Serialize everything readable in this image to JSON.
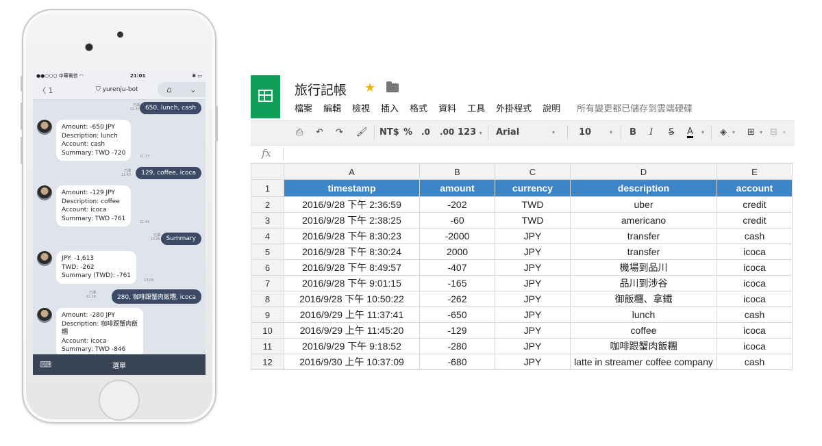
{
  "phone": {
    "status": {
      "carrier": "中華電信",
      "time": "21:01"
    },
    "header": {
      "back": "1",
      "title": "yurenju-bot"
    },
    "messages": [
      {
        "side": "right",
        "text": "650, lunch, cash",
        "read": "已讀",
        "time": "11:37"
      },
      {
        "side": "left",
        "text": "Amount: -650 JPY\nDescription: lunch\nAccount: cash\nSummary: TWD -720",
        "time": "11:37"
      },
      {
        "side": "right",
        "text": "129, coffee, icoca",
        "read": "已讀",
        "time": "11:45"
      },
      {
        "side": "left",
        "text": "Amount: -129 JPY\nDescription: coffee\nAccount: icoca\nSummary: TWD -761",
        "time": "11:45"
      },
      {
        "side": "right",
        "text": "Summary",
        "read": "已讀",
        "time": "13:09"
      },
      {
        "side": "left",
        "text": "JPY: -1,613\nTWD: -262\nSummary (TWD): -761",
        "time": "13:09"
      },
      {
        "side": "right",
        "text": "280, 咖啡跟蟹肉飯糰, icoca",
        "read": "已讀",
        "time": "21:18"
      },
      {
        "side": "left",
        "text": "Amount: -280 JPY\nDescription: 咖啡跟蟹肉飯\n糰\nAccount: icoca\nSummary: TWD -846",
        "time": "21:18"
      }
    ],
    "menu_label": "選單"
  },
  "sheet": {
    "title": "旅行記帳",
    "menu": [
      "檔案",
      "編輯",
      "檢視",
      "插入",
      "格式",
      "資料",
      "工具",
      "外掛程式",
      "說明"
    ],
    "saved_status": "所有變更都已儲存到雲端硬碟",
    "toolbar": {
      "currency": "NT$",
      "percent": "%",
      "dec_less": ".0",
      "dec_more": ".00",
      "format": "123",
      "font": "Arial",
      "size": "10",
      "bold": "B",
      "italic": "I",
      "strike": "S",
      "text_color": "A"
    },
    "fx": "fx",
    "columns": [
      "A",
      "B",
      "C",
      "D",
      "E"
    ],
    "header_row": {
      "num": "1",
      "cells": [
        "timestamp",
        "amount",
        "currency",
        "description",
        "account"
      ]
    },
    "rows": [
      {
        "num": "2",
        "cells": [
          "2016/9/28 下午 2:36:59",
          "-202",
          "TWD",
          "uber",
          "credit"
        ]
      },
      {
        "num": "3",
        "cells": [
          "2016/9/28 下午 2:38:25",
          "-60",
          "TWD",
          "americano",
          "credit"
        ]
      },
      {
        "num": "4",
        "cells": [
          "2016/9/28 下午 8:30:23",
          "-2000",
          "JPY",
          "transfer",
          "cash"
        ]
      },
      {
        "num": "5",
        "cells": [
          "2016/9/28 下午 8:30:24",
          "2000",
          "JPY",
          "transfer",
          "icoca"
        ]
      },
      {
        "num": "6",
        "cells": [
          "2016/9/28 下午 8:49:57",
          "-407",
          "JPY",
          "機場到品川",
          "icoca"
        ]
      },
      {
        "num": "7",
        "cells": [
          "2016/9/28 下午 9:01:15",
          "-165",
          "JPY",
          "品川到涉谷",
          "icoca"
        ]
      },
      {
        "num": "8",
        "cells": [
          "2016/9/28 下午 10:50:22",
          "-262",
          "JPY",
          "御飯糰、拿鐵",
          "icoca"
        ]
      },
      {
        "num": "9",
        "cells": [
          "2016/9/29 上午 11:37:41",
          "-650",
          "JPY",
          "lunch",
          "cash"
        ]
      },
      {
        "num": "10",
        "cells": [
          "2016/9/29 上午 11:45:20",
          "-129",
          "JPY",
          "coffee",
          "icoca"
        ]
      },
      {
        "num": "11",
        "cells": [
          "2016/9/29 下午 9:18:52",
          "-280",
          "JPY",
          "咖啡跟蟹肉飯糰",
          "icoca"
        ]
      },
      {
        "num": "12",
        "cells": [
          "2016/9/30 上午 10:37:09",
          "-680",
          "JPY",
          "latte in streamer coffee company",
          "cash"
        ]
      }
    ],
    "colors": {
      "header_fill": "#3d85c6",
      "logo": "#0f9d58"
    }
  }
}
